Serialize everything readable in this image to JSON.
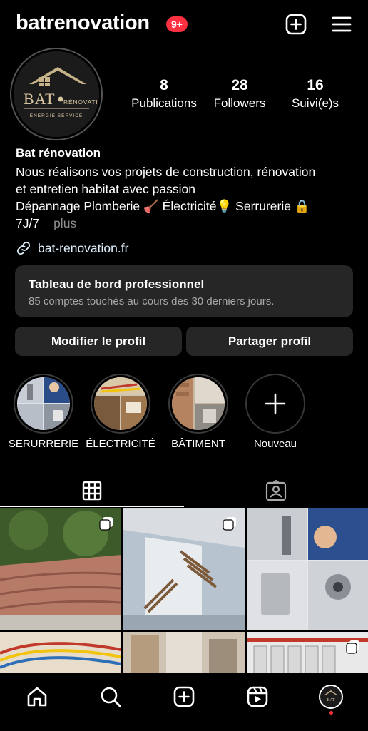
{
  "header": {
    "username": "batrenovation",
    "notification_badge": "9+",
    "icons": [
      "create-icon",
      "menu-icon"
    ]
  },
  "profile": {
    "stats": [
      {
        "value": "8",
        "label": "Publications"
      },
      {
        "value": "28",
        "label": "Followers"
      },
      {
        "value": "16",
        "label": "Suivi(e)s"
      }
    ],
    "name": "Bat rénovation",
    "bio_lines": [
      "Nous réalisons vos projets de construction, rénovation",
      "et entretien habitat avec passion",
      "Dépannage Plomberie 🪠 Électricité💡 Serrurerie 🔒",
      "7J/7"
    ],
    "more_label": "plus",
    "link": "bat-renovation.fr",
    "avatar_logo": {
      "line1": "BAT",
      "line2": "RÉNOVATION",
      "line3": "ENERGIE SERVICE"
    }
  },
  "dashboard": {
    "title": "Tableau de bord professionnel",
    "subtitle": "85 comptes touchés au cours des 30 derniers jours."
  },
  "buttons": {
    "edit_profile": "Modifier le profil",
    "share_profile": "Partager profil"
  },
  "highlights": [
    {
      "label": "SERURRERIE"
    },
    {
      "label": "ÉLECTRICITÉ"
    },
    {
      "label": "BÂTIMENT"
    },
    {
      "label": "Nouveau"
    }
  ],
  "tabs": [
    "grid-tab",
    "tagged-tab"
  ],
  "colors": {
    "background": "#000000",
    "surface": "#262626",
    "badge": "#ff3040",
    "muted_text": "#a8a8a8",
    "link_text": "#e0f1ff"
  },
  "bottom_nav": [
    "home",
    "search",
    "create",
    "reels",
    "profile"
  ]
}
